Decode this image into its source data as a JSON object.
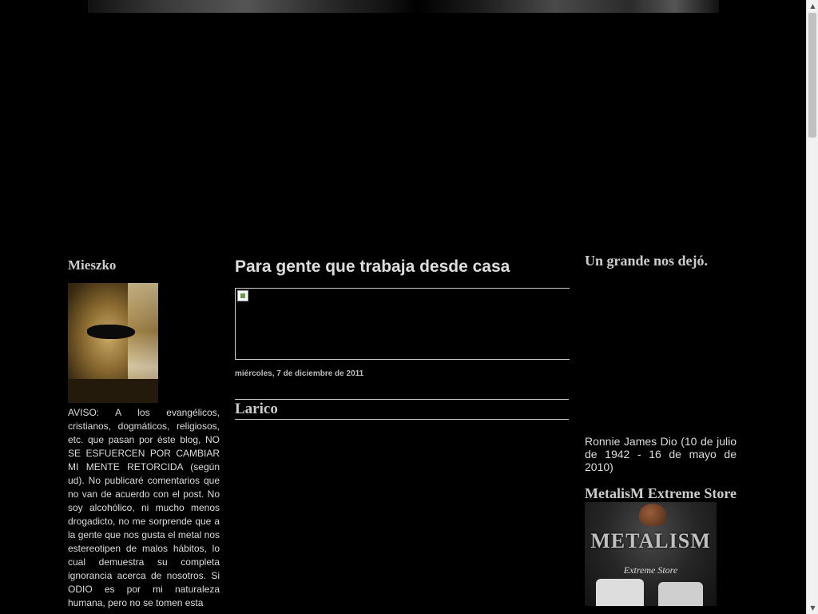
{
  "sidebar_left": {
    "title": "Mieszko",
    "aviso": "AVISO: A los evangélicos, cristianos, dogmáticos, religiosos, etc. que pasan por éste blog, NO SE ESFUERCEN POR CAMBIAR MI MENTE RETORCIDA (según ud). No publicaré comentarios que no van de acuerdo con el post. No soy alcohólico, ni mucho menos drogadicto, no me sorprende que a la gente que nos gusta el metal nos estereotipen de malos hábitos, lo cual demuestra su completa ignorancia acerca de nosotros. Si ODIO es por mi naturaleza humana, pero no se tomen esta"
  },
  "main": {
    "heading": "Para gente que trabaja desde casa",
    "date_header": "miércoles, 7 de diciembre de 2011",
    "post_title": "Larico"
  },
  "sidebar_right": {
    "dio_title": "Un grande nos dejó.",
    "dio_caption": "Ronnie James Dio (10 de julio de 1942 - 16 de mayo de 2010)",
    "store_title": "MetalisM Extreme Store",
    "store_logo": "METALISM",
    "store_subtitle": "Extreme Store"
  },
  "icons": {
    "scroll_up": "▲",
    "scroll_down": "▼"
  }
}
